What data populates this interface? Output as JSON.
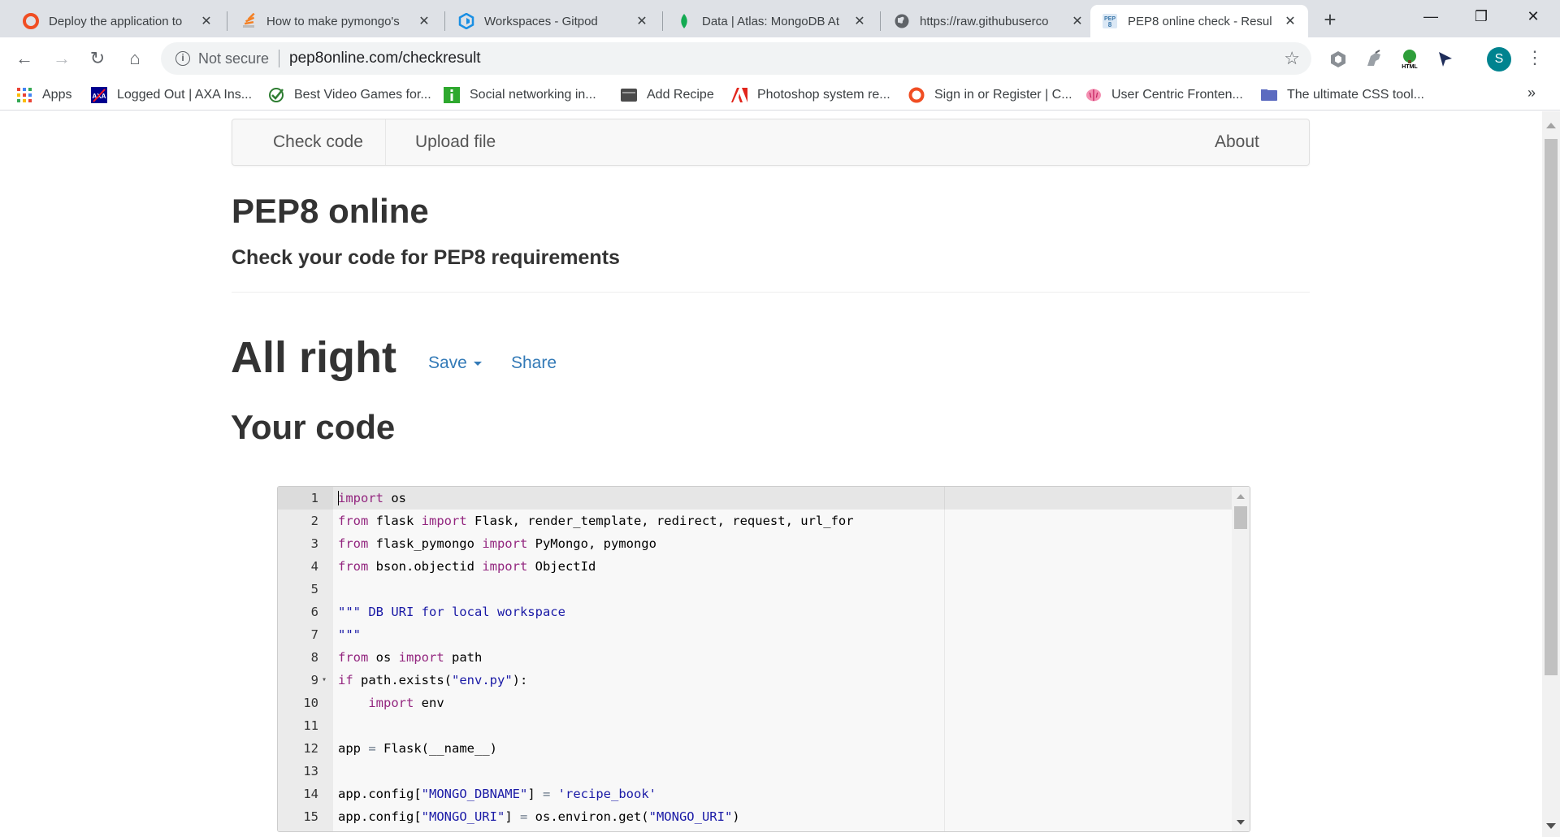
{
  "browser": {
    "tabs": [
      {
        "title": "Deploy the application to",
        "favicon": "circle-icon",
        "color": "#f04e23"
      },
      {
        "title": "How to make pymongo's",
        "favicon": "stackoverflow-icon",
        "color": "#f48024"
      },
      {
        "title": "Workspaces - Gitpod",
        "favicon": "gitpod-icon",
        "color": "#1a8fe3"
      },
      {
        "title": "Data | Atlas: MongoDB At",
        "favicon": "mongodb-leaf-icon",
        "color": "#13aa52"
      },
      {
        "title": "https://raw.githubuserco",
        "favicon": "globe-icon",
        "color": "#5f6368"
      },
      {
        "title": "PEP8 online check - Resul",
        "favicon": "pep8-icon",
        "color": "#3c78aa"
      }
    ],
    "tab_close_glyph": "✕",
    "new_tab_glyph": "+",
    "window_controls": {
      "minimize": "—",
      "maximize": "❐",
      "close": "✕"
    },
    "nav": {
      "back": "←",
      "forward": "→",
      "reload": "↻",
      "home": "⌂"
    },
    "omnibox": {
      "security": "Not secure",
      "url": "pep8online.com/checkresult",
      "info_glyph": "i",
      "star_glyph": "☆"
    },
    "profile_initial": "S",
    "menu_glyph": "⋮",
    "bookmarks": [
      {
        "label": "Apps",
        "icon": "apps-grid-icon"
      },
      {
        "label": "Logged Out | AXA Ins...",
        "icon": "axa-icon"
      },
      {
        "label": "Best Video Games for...",
        "icon": "checkmark-icon"
      },
      {
        "label": "Social networking in...",
        "icon": "info-green-icon"
      },
      {
        "label": "Add Recipe",
        "icon": "recipe-icon"
      },
      {
        "label": "Photoshop system re...",
        "icon": "adobe-icon"
      },
      {
        "label": "Sign in or Register | C...",
        "icon": "ring-icon"
      },
      {
        "label": "User Centric Fronten...",
        "icon": "brain-icon"
      },
      {
        "label": "The ultimate CSS tool...",
        "icon": "folder-icon"
      }
    ],
    "bookmarks_more": "»"
  },
  "site": {
    "nav": {
      "check_code": "Check code",
      "upload_file": "Upload file",
      "about": "About"
    },
    "title": "PEP8 online",
    "subtitle": "Check your code for PEP8 requirements",
    "result": "All right",
    "save": "Save",
    "share": "Share",
    "code_heading": "Your code"
  },
  "editor": {
    "lines": [
      {
        "n": "1",
        "tokens": [
          [
            "kw",
            "import"
          ],
          [
            "t",
            " os"
          ]
        ]
      },
      {
        "n": "2",
        "tokens": [
          [
            "kw",
            "from"
          ],
          [
            "t",
            " flask "
          ],
          [
            "kw",
            "import"
          ],
          [
            "t",
            " Flask, render_template, redirect, request, url_for"
          ]
        ]
      },
      {
        "n": "3",
        "tokens": [
          [
            "kw",
            "from"
          ],
          [
            "t",
            " flask_pymongo "
          ],
          [
            "kw",
            "import"
          ],
          [
            "t",
            " PyMongo, pymongo"
          ]
        ]
      },
      {
        "n": "4",
        "tokens": [
          [
            "kw",
            "from"
          ],
          [
            "t",
            " bson.objectid "
          ],
          [
            "kw",
            "import"
          ],
          [
            "t",
            " ObjectId"
          ]
        ]
      },
      {
        "n": "5",
        "tokens": []
      },
      {
        "n": "6",
        "tokens": [
          [
            "str",
            "\"\"\" DB URI for local workspace"
          ]
        ]
      },
      {
        "n": "7",
        "tokens": [
          [
            "str",
            "\"\"\""
          ]
        ]
      },
      {
        "n": "8",
        "tokens": [
          [
            "kw",
            "from"
          ],
          [
            "t",
            " os "
          ],
          [
            "kw",
            "import"
          ],
          [
            "t",
            " path"
          ]
        ]
      },
      {
        "n": "9",
        "fold": "▾",
        "tokens": [
          [
            "kw",
            "if"
          ],
          [
            "t",
            " path.exists("
          ],
          [
            "str",
            "\"env.py\""
          ],
          [
            "t",
            "):"
          ]
        ]
      },
      {
        "n": "10",
        "tokens": [
          [
            "t",
            "    "
          ],
          [
            "kw",
            "import"
          ],
          [
            "t",
            " env"
          ]
        ]
      },
      {
        "n": "11",
        "tokens": []
      },
      {
        "n": "12",
        "tokens": [
          [
            "t",
            "app "
          ],
          [
            "op",
            "="
          ],
          [
            "t",
            " Flask(__name__)"
          ]
        ]
      },
      {
        "n": "13",
        "tokens": []
      },
      {
        "n": "14",
        "tokens": [
          [
            "t",
            "app.config["
          ],
          [
            "str",
            "\"MONGO_DBNAME\""
          ],
          [
            "t",
            "] "
          ],
          [
            "op",
            "="
          ],
          [
            "t",
            " "
          ],
          [
            "str",
            "'recipe_book'"
          ]
        ]
      },
      {
        "n": "15",
        "tokens": [
          [
            "t",
            "app.config["
          ],
          [
            "str",
            "\"MONGO_URI\""
          ],
          [
            "t",
            "] "
          ],
          [
            "op",
            "="
          ],
          [
            "t",
            " os.environ.get("
          ],
          [
            "str",
            "\"MONGO_URI\""
          ],
          [
            "t",
            ")"
          ]
        ]
      }
    ]
  },
  "colors": {
    "link": "#337ab7",
    "keyword": "#93267f",
    "string": "#1a1aa6",
    "heading": "#333333"
  }
}
